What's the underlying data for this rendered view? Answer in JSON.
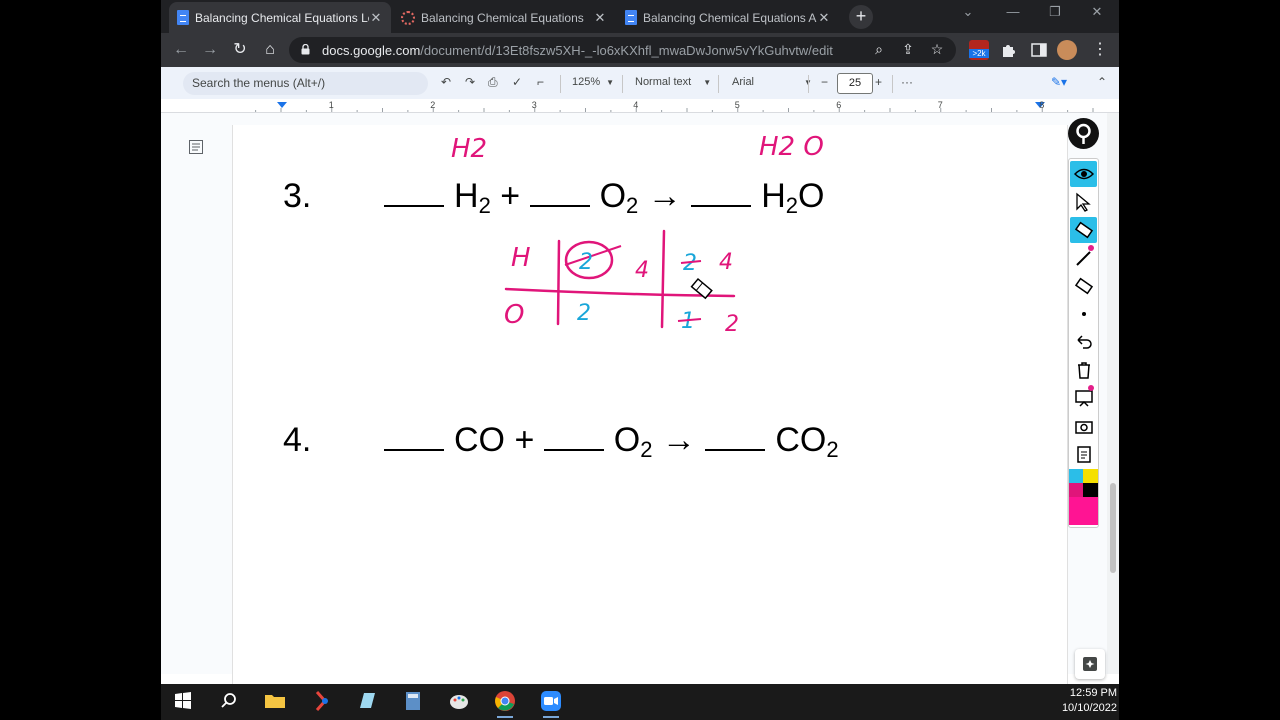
{
  "browser": {
    "tabs": [
      {
        "title": "Balancing Chemical Equations Le",
        "icon": "docs-icon",
        "active": true
      },
      {
        "title": "Balancing Chemical Equations",
        "icon": "loading-icon",
        "active": false
      },
      {
        "title": "Balancing Chemical Equations A",
        "icon": "docs-icon",
        "active": false
      }
    ],
    "url_host": "docs.google.com",
    "url_path": "/document/d/13Et8fszw5XH-_-lo6xKXhfl_mwaDwJonw5vYkGuhvtw/edit",
    "extension_badge": ">2k"
  },
  "toolbar": {
    "search_placeholder": "Search the menus (Alt+/)",
    "zoom": "125%",
    "style": "Normal text",
    "font": "Arial",
    "font_size": "25"
  },
  "ruler": {
    "labels": [
      "1",
      "2",
      "3",
      "4",
      "5",
      "6",
      "7",
      "8"
    ]
  },
  "document": {
    "problem3": {
      "number": "3.",
      "reactant1": "H",
      "reactant1_sub": "2",
      "plus": "+",
      "reactant2": "O",
      "reactant2_sub": "2",
      "arrow": "→",
      "product": "H",
      "product_sub": "2",
      "product_tail": "O"
    },
    "problem4": {
      "number": "4.",
      "reactant1": "CO",
      "plus": "+",
      "reactant2": "O",
      "reactant2_sub": "2",
      "arrow": "→",
      "product": "CO",
      "product_sub": "2"
    },
    "ink": {
      "reactant_label": "H2",
      "product_label": "H2 O",
      "rows": [
        "H",
        "O"
      ],
      "left_h": [
        "2",
        "4"
      ],
      "left_o": [
        "2"
      ],
      "right_h": [
        "2",
        "4"
      ],
      "right_o": [
        "1",
        "2"
      ]
    }
  },
  "taskbar": {
    "time": "12:59 PM",
    "date": "10/10/2022"
  },
  "colors": {
    "ink_pink": "#e0157a",
    "ink_blue": "#19a6d9",
    "accent": "#2bbee8"
  }
}
